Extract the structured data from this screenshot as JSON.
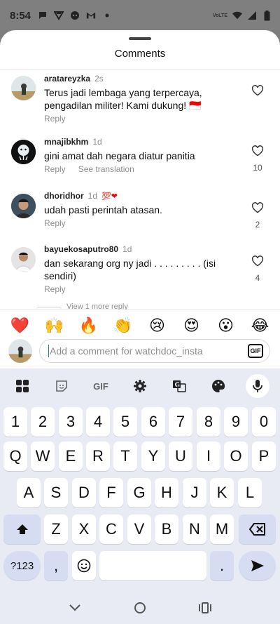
{
  "status_bar": {
    "time": "8:54",
    "network_label": "VoLTE"
  },
  "sheet": {
    "title": "Comments"
  },
  "comments": [
    {
      "username": "aratareyzka",
      "time": "2s",
      "text": "Terus jadi lembaga yang terpercaya, pengadilan militer! Kami dukung! 🇮🇩",
      "reply": "Reply",
      "likes": ""
    },
    {
      "username": "mnajibkhm",
      "time": "1d",
      "text": "gini amat dah negara diatur panitia",
      "reply": "Reply",
      "see_translation": "See translation",
      "likes": "10"
    },
    {
      "username": "dhoridhor",
      "time": "1d",
      "badge": "💯❤",
      "text": "udah pasti perintah atasan.",
      "reply": "Reply",
      "likes": "2"
    },
    {
      "username": "bayuekosaputro80",
      "time": "1d",
      "text": "dan sekarang org ny jadi . . . . . . . . . (isi sendiri)",
      "reply": "Reply",
      "likes": "4"
    }
  ],
  "more_replies": "View 1 more reply",
  "reactions": [
    "❤️",
    "🙌",
    "🔥",
    "👏",
    "😢",
    "😍",
    "😮",
    "😂"
  ],
  "composer": {
    "placeholder": "Add a comment for watchdoc_insta",
    "gif_label": "GIF"
  },
  "keyboard": {
    "toolbar": {
      "gif_label": "GIF"
    },
    "row_numbers": [
      "1",
      "2",
      "3",
      "4",
      "5",
      "6",
      "7",
      "8",
      "9",
      "0"
    ],
    "row_q": [
      "Q",
      "W",
      "E",
      "R",
      "T",
      "Y",
      "U",
      "I",
      "O",
      "P"
    ],
    "row_a": [
      "A",
      "S",
      "D",
      "F",
      "G",
      "H",
      "J",
      "K",
      "L"
    ],
    "row_z": [
      "Z",
      "X",
      "C",
      "V",
      "B",
      "N",
      "M"
    ],
    "symbols_label": "?123",
    "comma": ",",
    "period": "."
  }
}
